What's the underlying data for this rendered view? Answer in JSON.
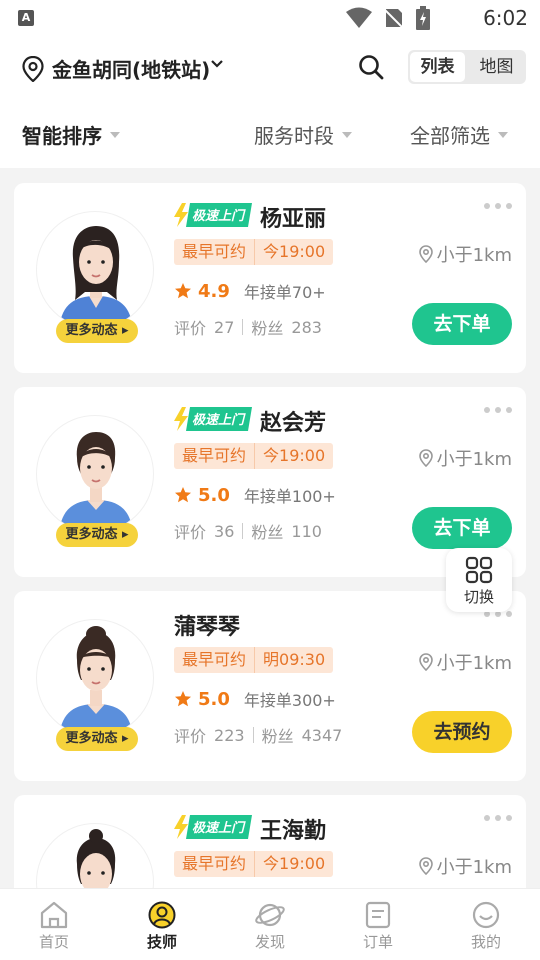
{
  "status_bar": {
    "app_letter": "A",
    "time": "6:02"
  },
  "header": {
    "location": "金鱼胡同(地铁站)",
    "view_list": "列表",
    "view_map": "地图"
  },
  "filters": {
    "sort": "智能排序",
    "time_slot": "服务时段",
    "all_filter": "全部筛选"
  },
  "badge_text": "极速上门",
  "cards": [
    {
      "name": "杨亚丽",
      "express": true,
      "avail_label": "最早可约",
      "avail_time": "今19:00",
      "distance": "小于1km",
      "score": "4.9",
      "orders": "年接单70+",
      "reviews_label": "评价",
      "reviews": "27",
      "fans_label": "粉丝",
      "fans": "283",
      "action": "去下单",
      "more": "更多动态"
    },
    {
      "name": "赵会芳",
      "express": true,
      "avail_label": "最早可约",
      "avail_time": "今19:00",
      "distance": "小于1km",
      "score": "5.0",
      "orders": "年接单100+",
      "reviews_label": "评价",
      "reviews": "36",
      "fans_label": "粉丝",
      "fans": "110",
      "action": "去下单",
      "more": "更多动态"
    },
    {
      "name": "蒲琴琴",
      "express": false,
      "avail_label": "最早可约",
      "avail_time": "明09:30",
      "distance": "小于1km",
      "score": "5.0",
      "orders": "年接单300+",
      "reviews_label": "评价",
      "reviews": "223",
      "fans_label": "粉丝",
      "fans": "4347",
      "action": "去预约",
      "more": "更多动态"
    },
    {
      "name": "王海勤",
      "express": true,
      "avail_label": "最早可约",
      "avail_time": "今19:00",
      "distance": "小于1km"
    }
  ],
  "switch_button": "切换",
  "tabs": [
    {
      "label": "首页",
      "icon": "home-icon"
    },
    {
      "label": "技师",
      "icon": "technician-icon"
    },
    {
      "label": "发现",
      "icon": "discover-icon"
    },
    {
      "label": "订单",
      "icon": "order-icon"
    },
    {
      "label": "我的",
      "icon": "profile-icon"
    }
  ],
  "colors": {
    "green": "#1fc58f",
    "yellow": "#f8d12a",
    "orange": "#f07a16",
    "badge": "#1fc58f"
  }
}
